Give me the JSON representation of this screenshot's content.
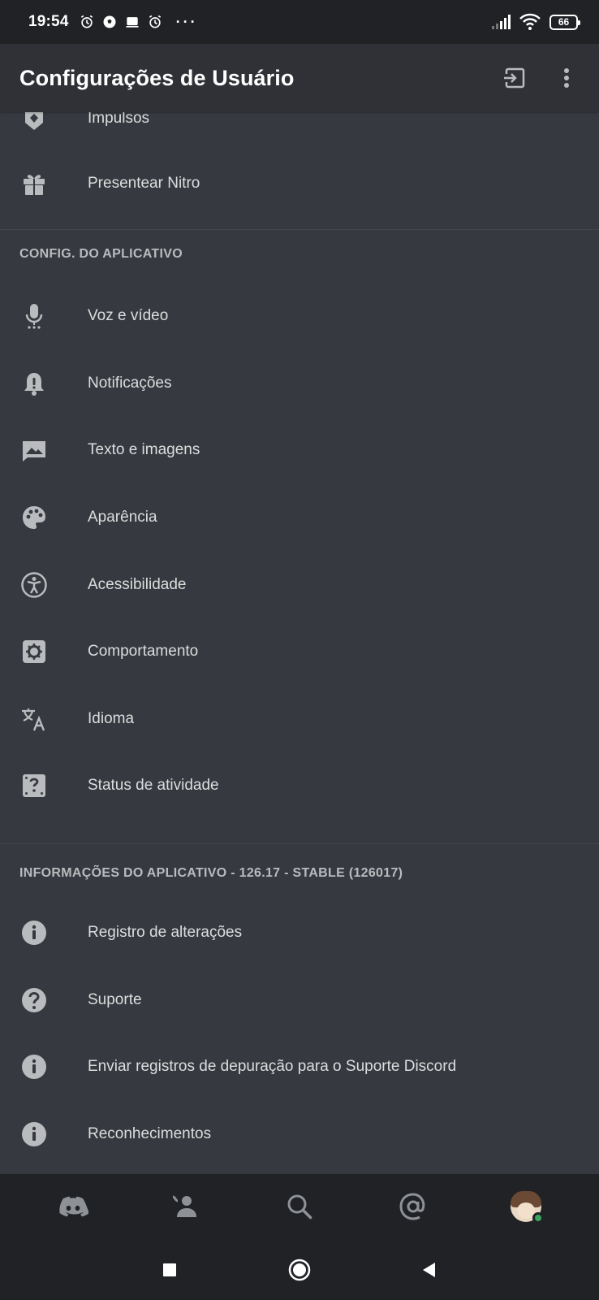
{
  "status_bar": {
    "time": "19:54",
    "overflow_dots": "···",
    "battery": "66"
  },
  "header": {
    "title": "Configurações de Usuário"
  },
  "items_top": [
    {
      "label": "Impulsos",
      "icon": "boost-icon"
    },
    {
      "label": "Presentear Nitro",
      "icon": "gift-icon"
    }
  ],
  "section_app_settings": {
    "title": "CONFIG. DO APLICATIVO",
    "items": [
      {
        "label": "Voz e vídeo",
        "icon": "microphone-icon"
      },
      {
        "label": "Notificações",
        "icon": "bell-icon"
      },
      {
        "label": "Texto e imagens",
        "icon": "image-icon"
      },
      {
        "label": "Aparência",
        "icon": "palette-icon"
      },
      {
        "label": "Acessibilidade",
        "icon": "accessibility-icon"
      },
      {
        "label": "Comportamento",
        "icon": "gear-icon"
      },
      {
        "label": "Idioma",
        "icon": "translate-icon"
      },
      {
        "label": "Status de atividade",
        "icon": "activity-icon"
      }
    ]
  },
  "section_app_info": {
    "title": "INFORMAÇÕES DO APLICATIVO - 126.17 - STABLE (126017)",
    "items": [
      {
        "label": "Registro de alterações",
        "icon": "info-icon"
      },
      {
        "label": "Suporte",
        "icon": "help-icon"
      },
      {
        "label": "Enviar registros de depuração para o Suporte Discord",
        "icon": "info-icon"
      },
      {
        "label": "Reconhecimentos",
        "icon": "info-icon"
      }
    ]
  },
  "bottom_nav": [
    "discord-home-icon",
    "friends-icon",
    "search-icon",
    "mentions-icon",
    "avatar"
  ],
  "colors": {
    "background": "#36393f",
    "header_bg": "#2f3136",
    "nav_bg": "#202225",
    "text": "#dcddde",
    "muted": "#b9bbbe",
    "online": "#3ba55d"
  }
}
